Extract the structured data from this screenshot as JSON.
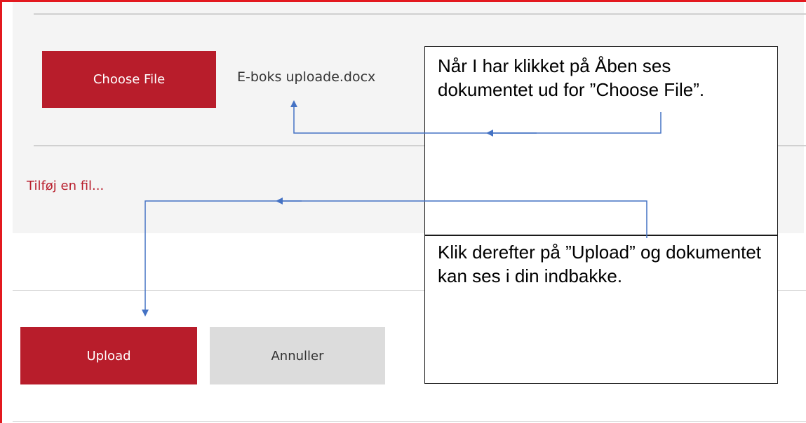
{
  "upload": {
    "choose_file_label": "Choose File",
    "selected_file_name": "E-boks uploade.docx",
    "add_file_link": "Tilføj en fil...",
    "upload_label": "Upload",
    "cancel_label": "Annuller"
  },
  "annotations": {
    "callout_1": "Når I har klikket på Åben ses dokumentet ud for ”Choose File”.",
    "callout_2": "Klik derefter på ”Upload” og dokumentet kan ses i din indbakke."
  },
  "colors": {
    "primary": "#b81d2b",
    "frame": "#e3191f",
    "arrow": "#4472c4"
  }
}
